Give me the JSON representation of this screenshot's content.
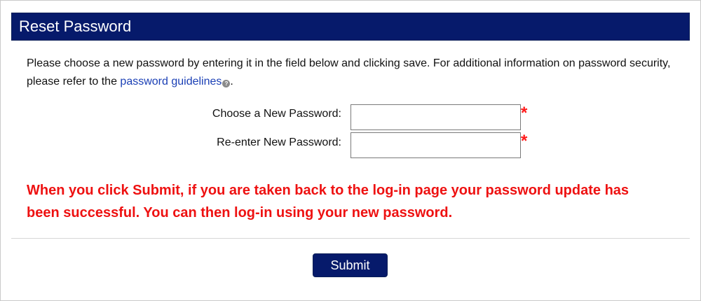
{
  "header": {
    "title": "Reset Password"
  },
  "intro": {
    "text_before": "Please choose a new password by entering it in the field below and clicking save. For additional information on password security, please refer to the ",
    "link_text": "password guidelines",
    "help_icon_glyph": "?",
    "text_after": "."
  },
  "form": {
    "new_password_label": "Choose a New Password:",
    "new_password_value": "",
    "reenter_label": "Re-enter New Password:",
    "reenter_value": "",
    "required_marker": "*"
  },
  "warning": {
    "text": "When you click Submit, if you are taken back to the log-in page your password update has been successful. You can then log-in using your new password."
  },
  "actions": {
    "submit_label": "Submit"
  },
  "colors": {
    "header_bg": "#061a6b",
    "link": "#1a3fb5",
    "warning": "#ee1111",
    "required": "#ff1a1a"
  },
  "icons": {
    "help": "question-circle-icon"
  }
}
